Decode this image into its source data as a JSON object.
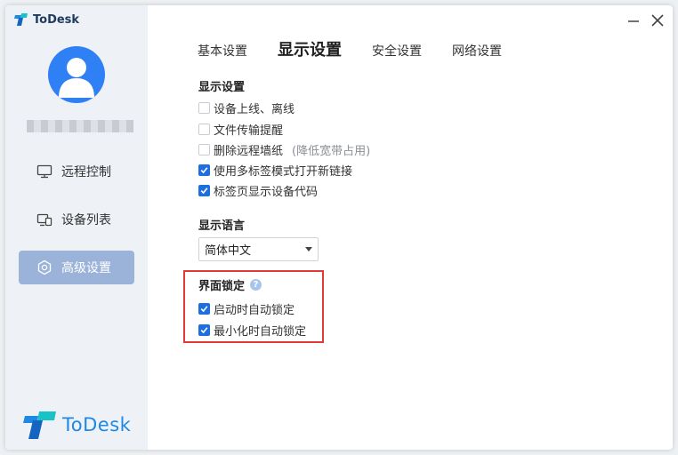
{
  "app": {
    "name": "ToDesk"
  },
  "sidebar": {
    "items": [
      {
        "label": "远程控制",
        "icon": "monitor-icon"
      },
      {
        "label": "设备列表",
        "icon": "devices-icon"
      },
      {
        "label": "高级设置",
        "icon": "gear-icon",
        "active": true
      }
    ]
  },
  "tabs": [
    {
      "label": "基本设置"
    },
    {
      "label": "显示设置",
      "active": true
    },
    {
      "label": "安全设置"
    },
    {
      "label": "网络设置"
    }
  ],
  "display": {
    "title": "显示设置",
    "options": [
      {
        "label": "设备上线、离线",
        "checked": false
      },
      {
        "label": "文件传输提醒",
        "checked": false
      },
      {
        "label": "删除远程墙纸",
        "note": "(降低宽带占用)",
        "checked": false
      },
      {
        "label": "使用多标签模式打开新链接",
        "checked": true
      },
      {
        "label": "标签页显示设备代码",
        "checked": true
      }
    ]
  },
  "language": {
    "title": "显示语言",
    "selected": "简体中文"
  },
  "lock": {
    "title": "界面锁定",
    "help_icon": "?",
    "options": [
      {
        "label": "启动时自动锁定",
        "checked": true
      },
      {
        "label": "最小化时自动锁定",
        "checked": true
      }
    ]
  },
  "colors": {
    "accent": "#1d6fe0",
    "sidebar_active": "#9bb3d9",
    "highlight_box": "#e23a3a"
  }
}
